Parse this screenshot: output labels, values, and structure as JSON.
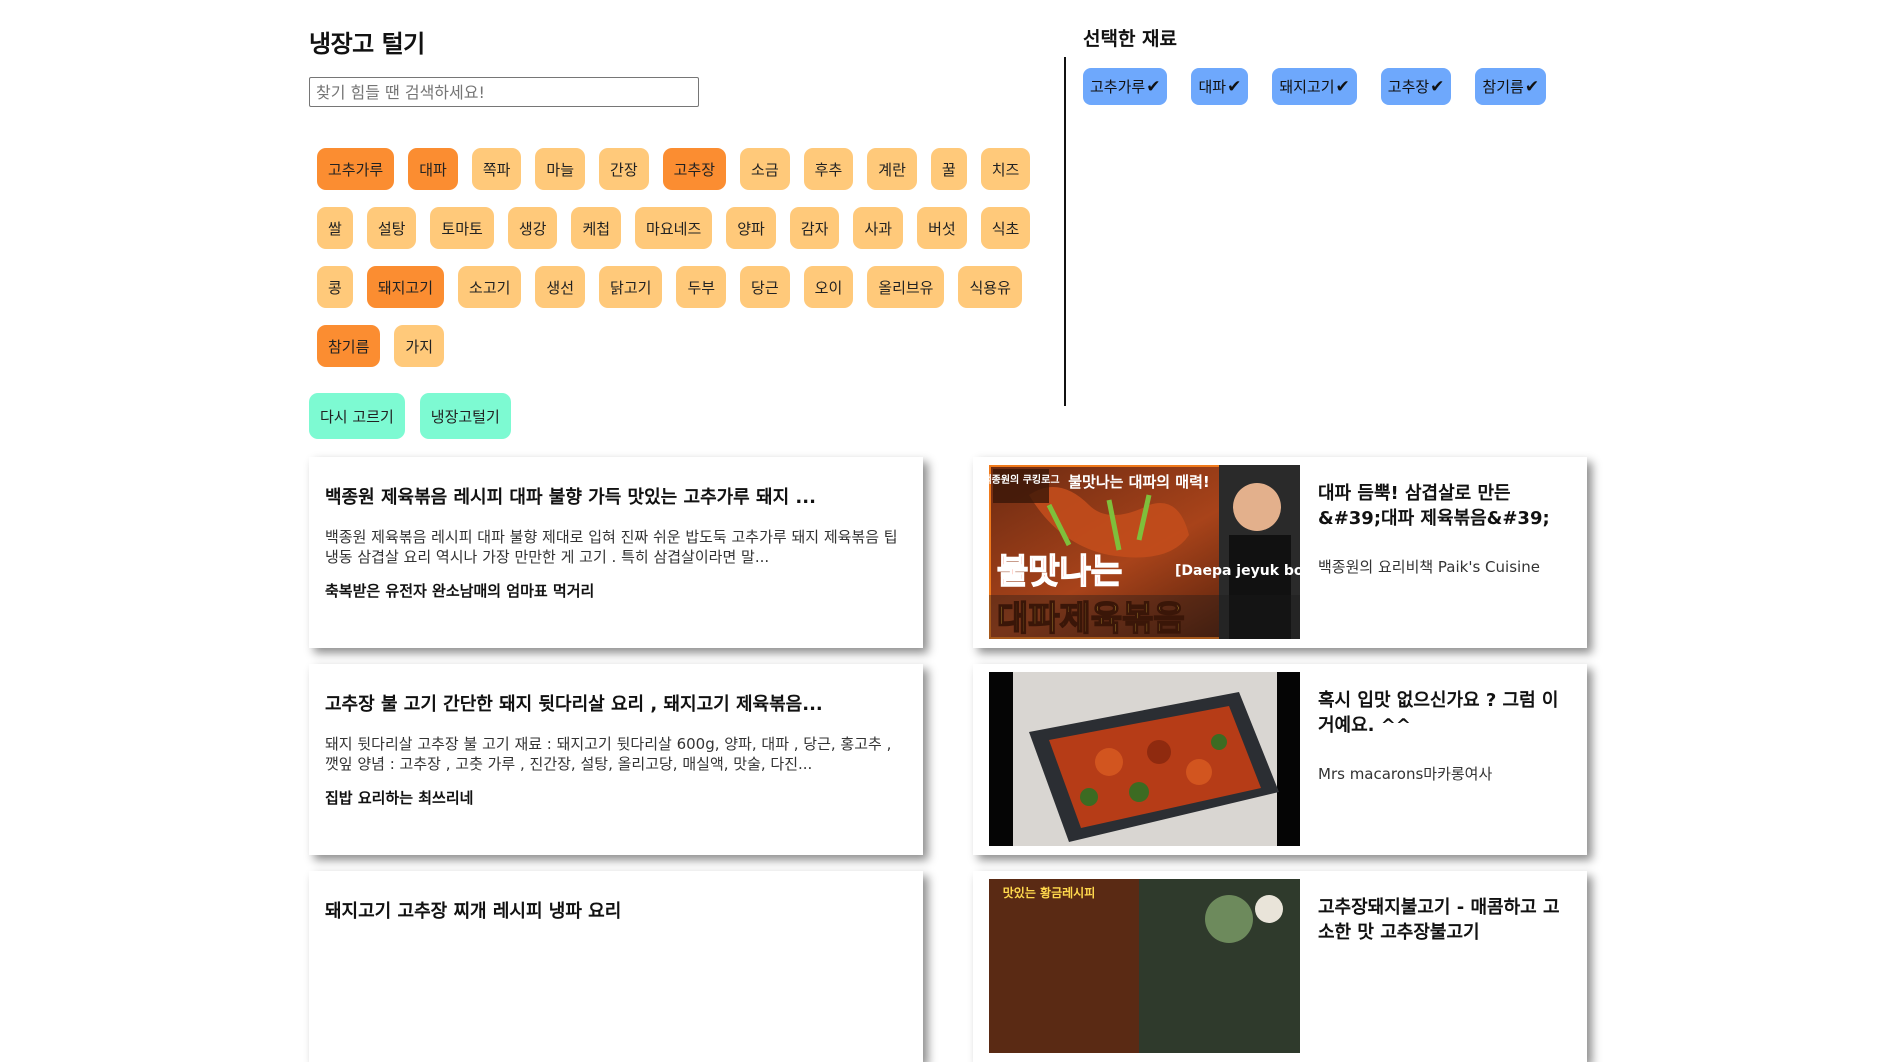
{
  "header": {
    "title": "냉장고 털기"
  },
  "search": {
    "placeholder": "찾기 힘들 땐 검색하세요!"
  },
  "ingredients": [
    {
      "label": "고추가루",
      "selected": true
    },
    {
      "label": "대파",
      "selected": true
    },
    {
      "label": "쪽파",
      "selected": false
    },
    {
      "label": "마늘",
      "selected": false
    },
    {
      "label": "간장",
      "selected": false
    },
    {
      "label": "고추장",
      "selected": true
    },
    {
      "label": "소금",
      "selected": false
    },
    {
      "label": "후추",
      "selected": false
    },
    {
      "label": "계란",
      "selected": false
    },
    {
      "label": "꿀",
      "selected": false
    },
    {
      "label": "치즈",
      "selected": false
    },
    {
      "label": "쌀",
      "selected": false
    },
    {
      "label": "설탕",
      "selected": false
    },
    {
      "label": "토마토",
      "selected": false
    },
    {
      "label": "생강",
      "selected": false
    },
    {
      "label": "케첩",
      "selected": false
    },
    {
      "label": "마요네즈",
      "selected": false
    },
    {
      "label": "양파",
      "selected": false
    },
    {
      "label": "감자",
      "selected": false
    },
    {
      "label": "사과",
      "selected": false
    },
    {
      "label": "버섯",
      "selected": false
    },
    {
      "label": "식초",
      "selected": false
    },
    {
      "label": "콩",
      "selected": false
    },
    {
      "label": "돼지고기",
      "selected": true
    },
    {
      "label": "소고기",
      "selected": false
    },
    {
      "label": "생선",
      "selected": false
    },
    {
      "label": "닭고기",
      "selected": false
    },
    {
      "label": "두부",
      "selected": false
    },
    {
      "label": "당근",
      "selected": false
    },
    {
      "label": "오이",
      "selected": false
    },
    {
      "label": "올리브유",
      "selected": false
    },
    {
      "label": "식용유",
      "selected": false
    },
    {
      "label": "참기름",
      "selected": true
    },
    {
      "label": "가지",
      "selected": false
    }
  ],
  "actions": {
    "reset_label": "다시 고르기",
    "submit_label": "냉장고털기"
  },
  "selected_panel": {
    "title": "선택한 재료",
    "check_glyph": "✔",
    "items": [
      "고추가루",
      "대파",
      "돼지고기",
      "고추장",
      "참기름"
    ]
  },
  "blog_results": [
    {
      "title": "백종원 제육볶음 레시피 대파 불향 가득 맛있는 고추가루 돼지 ...",
      "description": "백종원 제육볶음 레시피 대파 불향 제대로 입혀 진짜 쉬운 밥도둑 고추가루 돼지 제육볶음 팁 냉동 삼겹살 요리 역시나 가장 만만한 게 고기 . 특히 삼겹살이라면 말...",
      "author": "축복받은 유전자 완소남매의 엄마표 먹거리"
    },
    {
      "title": "고추장 불 고기 간단한 돼지 뒷다리살 요리 , 돼지고기 제육볶음...",
      "description": "돼지 뒷다리살 고추장 불 고기 재료 : 돼지고기 뒷다리살 600g, 양파, 대파 , 당근, 홍고추 , 깻잎 양념 : 고추장 , 고춧 가루 , 진간장, 설탕, 올리고당, 매실액, 맛술, 다진...",
      "author": "집밥 요리하는 최쓰리네"
    },
    {
      "title": "돼지고기 고추장 찌개 레시피 냉파 요리",
      "description": "",
      "author": ""
    }
  ],
  "video_results": [
    {
      "title": "대파 듬뿍! 삼겹살로 만든 &#39;대파 제육볶음&#39;",
      "channel": "백종원의 요리비책 Paik's Cuisine",
      "thumb_text": {
        "badge": "백종원의 쿠킹로그",
        "top": "불맛나는 대파의 매력!",
        "big1": "불맛나는",
        "big2": "대파제육볶음",
        "eng": "[Daepa jeyuk bokkeum]"
      }
    },
    {
      "title": "혹시 입맛 없으신가요 ? 그럼 이거예요. ^^",
      "channel": "Mrs macarons마카롱여사",
      "thumb_text": {}
    },
    {
      "title": "고추장돼지불고기 - 매콤하고 고소한 맛 고추장불고기",
      "channel": "",
      "thumb_text": {
        "badge": "맛있는 황금레시피"
      }
    }
  ],
  "colors": {
    "chip": "#ffc97a",
    "chip_selected": "#fb8d31",
    "selected_chip": "#6ea8fc",
    "action_button": "#7dfad2"
  }
}
